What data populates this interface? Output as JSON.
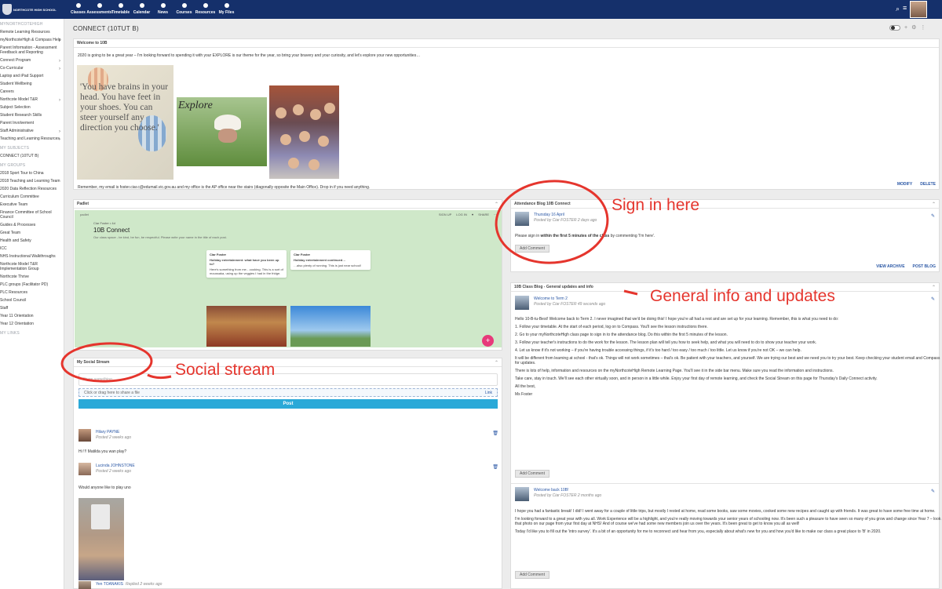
{
  "topbar": {
    "logo_text": "NORTHCOTE HIGH SCHOOL",
    "nav": [
      "Classes",
      "Assessments",
      "Timetable",
      "Calendar",
      "News",
      "Courses",
      "Resources",
      "My Files"
    ],
    "bg": "#15306b"
  },
  "sidebar": {
    "items": [
      {
        "label": "MYNORTHCOTEHIGH",
        "head": true
      },
      {
        "label": "Remote Learning Resources"
      },
      {
        "label": "myNorthcoteHigh & Compass Help",
        "chev": true
      },
      {
        "label": "Parent Information - Assessment Feedback and Reporting"
      },
      {
        "label": "Connect Program",
        "chev": true
      },
      {
        "label": "Co-Curricular",
        "chev": true
      },
      {
        "label": "Laptop and iPad Support"
      },
      {
        "label": "Student Wellbeing"
      },
      {
        "label": "Careers"
      },
      {
        "label": "Northcote Model T&R",
        "chev": true
      },
      {
        "label": "Subject Selection"
      },
      {
        "label": "Student Research Skills"
      },
      {
        "label": "Parent Involvement"
      },
      {
        "label": "Staff Administrative",
        "chev": true
      },
      {
        "label": "Teaching and Learning Resources",
        "chev": true
      },
      {
        "label": "MY SUBJECTS",
        "head": true
      },
      {
        "label": "CONNECT (10TUT B)"
      },
      {
        "label": "MY GROUPS",
        "head": true
      },
      {
        "label": "2018 Sport Tour to China"
      },
      {
        "label": "2018 Teaching and Learning Team"
      },
      {
        "label": "2020 Data Reflection Resources"
      },
      {
        "label": "Curriculum Committee"
      },
      {
        "label": "Executive Team"
      },
      {
        "label": "Finance Committee of School Council"
      },
      {
        "label": "Guides & Processes"
      },
      {
        "label": "Great Team"
      },
      {
        "label": "Health and Safety"
      },
      {
        "label": "ICC"
      },
      {
        "label": "NHS Instructional Walkthroughs"
      },
      {
        "label": "Northcote Model T&R Implementation Group"
      },
      {
        "label": "Northcote Thrive"
      },
      {
        "label": "PLC groups (Facilitator PD)"
      },
      {
        "label": "PLC Resources"
      },
      {
        "label": "School Council"
      },
      {
        "label": "Staff"
      },
      {
        "label": "Year 11 Orientation"
      },
      {
        "label": "Year 12 Orientation"
      },
      {
        "label": "MY LINKS",
        "head": true
      }
    ]
  },
  "page": {
    "title": "CONNECT (10TUT B)"
  },
  "welcome": {
    "heading": "Welcome to 10B",
    "intro": "2020 is going to be a great year – I'm looking forward to spending it with your EXPLORE is our theme for the year, so bring your bravery and your curiosity, and let's explore your new opportunities…",
    "quote": "'You have brains in your head. You have feet in your shoes. You can steer yourself any direction you choose.'",
    "explore_word": "Explore",
    "footer": "Remember, my email is foster.ciar.c@edumail.vic.gov.au and my office is the AP office near the stairs (diagonally opposite the Main Office). Drop in if you need anything.",
    "modify": "MODIFY",
    "delete": "DELETE"
  },
  "padlet": {
    "heading": "Padlet",
    "top_label": "padlet",
    "actions": [
      "SIGN UP",
      "LOG IN",
      "♥",
      "SHARE",
      "⋯"
    ],
    "author": "Ciar Foster • 4d",
    "title": "10B Connect",
    "subtitle": "Our class space - be kind, be fun, be respectful. Please write your name in the title of each post.",
    "cards": [
      {
        "name": "Ciar Foster",
        "title": "Holiday entertainment: what have you been up to?",
        "text": "Here's something from me…cooking. This is a sort of moussaka, using up the veggies I had in the fridge."
      },
      {
        "name": "Ciar Foster",
        "title": "Holiday entertainment continued…",
        "text": "…also plenty of running. This is just near school!"
      }
    ],
    "fab": "+"
  },
  "social": {
    "heading": "My Social Stream",
    "placeholder": "Share something…",
    "drop_text": "Click or drag here to share a file",
    "link_label": "Link",
    "post_label": "Post",
    "items": [
      {
        "name": "Hilary PAYNE",
        "time": "Posted 2 weeks ago",
        "text": "Hi !!! Matilda you wan play?"
      },
      {
        "name": "Lucinda JOHNSTONE",
        "time": "Posted 2 weeks ago",
        "text": "Would anyone like to play uno"
      },
      {
        "name": "Yen TOANAKIS",
        "time": "Replied 2 weeks ago",
        "text": ""
      }
    ]
  },
  "attendance": {
    "heading": "Attendance Blog 10B Connect",
    "entry_title": "Thursday 16 April",
    "entry_meta": "Posted by Ciar FOSTER 2 days ago",
    "text_before": "Please sign in",
    "text_bold": "within the first 5 minutes of the class",
    "text_after": "by commenting 'I'm here'.",
    "add_comment": "Add Comment",
    "view_archive": "VIEW ARCHIVE",
    "post_blog": "POST BLOG"
  },
  "classblog": {
    "heading": "10B Class Blog - General updates and info",
    "entry1_title": "Welcome to Term 2",
    "entry1_meta": "Posted by Ciar FOSTER 49 seconds ago",
    "entry1_paras": [
      "Hello 10-B-tu-Best! Welcome back to Term 2. I never imagined that we'd be doing this! I hope you're all had a rest and are set up for your learning. Remember, this is what you need to do:",
      "1. Follow your timetable. At the start of each period, log on to Compass. You'll see the lesson instructions there.",
      "2. Go to your myNorthcoteHigh class page to sign in to the attendance blog. Do this within the first 5 minutes of the lesson.",
      "3. Follow your teacher's instructions to do the work for the lesson. The lesson plan will tell you how to seek help, and what you will need to do to show your teacher your work.",
      "4. Let us know if it's not working – if you're having trouble accessing things, if it's too hard / too easy / too much / too little. Let us know if you're not OK – we can help.",
      "It will be different from learning at school - that's ok. Things will not work sometimes – that's ok. Be patient with your teachers, and yourself. We are trying our best and we need you to try your best. Keep checking your student email and Compass for updates.",
      "There is lots of help, information and resources on the myNorthcoteHigh Remote Learning Page. You'll see it in the side bar menu. Make sure you read the information and instructions.",
      "Take care, stay in touch. We'll see each other virtually soon, and in person in a little while. Enjoy your first day of remote learning, and check the Social Stream on this page for Thursday's Daily Connect activity.",
      "All the best,",
      "Ms Foster"
    ],
    "add_comment": "Add Comment",
    "entry2_title": "Welcome back 10B!",
    "entry2_meta": "Posted by Ciar FOSTER 2 months ago",
    "entry2_paras": [
      "I hope you had a fantastic break! I did! I went away for a couple of little trips, but mostly I rested at home, read some books, saw some movies, cooked some new recipes and caught up with friends. It was great to have some free time at home.",
      "I'm looking forward to a great year with you all. Work Experience will be a highlight, and you're really moving towards your senior years of schooling now. It's been such a pleasure to have seen so many of you grow and change since Year 7 – look at that photo on our page from your first day at NHS! And of course we've had some new members join us over the years. It's been great to get to know you all as well!",
      "Today I'd like you to fill out the 'intro survey'. It's a bit of an opportunity for me to reconnect and hear from you, especially about what's new for you and how you'd like to make our class a great place to 'B' in 2020."
    ]
  },
  "annotations": {
    "sign_in": "Sign in here",
    "general": "General info and updates",
    "social": "Social stream",
    "color": "#e5352d"
  }
}
